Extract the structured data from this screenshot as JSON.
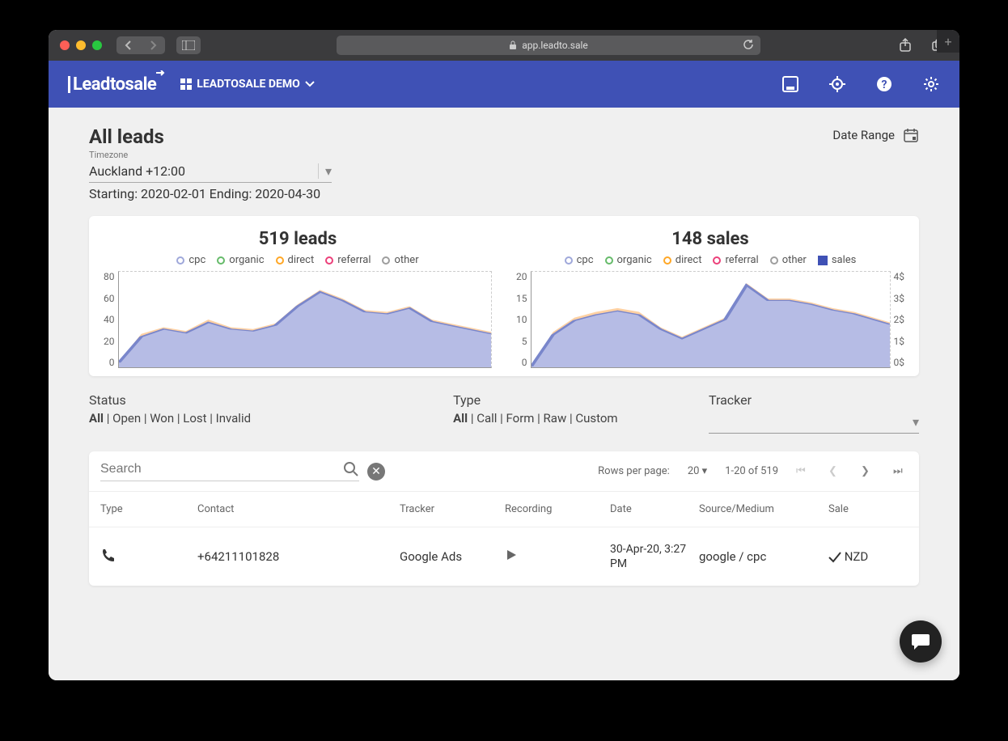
{
  "browser": {
    "url_host": "app.leadto.sale"
  },
  "header": {
    "brand": "Leadtosale",
    "account_selector": "LEADTOSALE DEMO"
  },
  "page": {
    "title": "All leads",
    "timezone_label": "Timezone",
    "timezone_value": "Auckland +12:00",
    "date_summary": "Starting: 2020-02-01 Ending: 2020-04-30",
    "date_range_label": "Date Range"
  },
  "charts": {
    "leads": {
      "title": "519 leads",
      "legend": [
        "cpc",
        "organic",
        "direct",
        "referral",
        "other"
      ]
    },
    "sales": {
      "title": "148 sales",
      "legend": [
        "cpc",
        "organic",
        "direct",
        "referral",
        "other",
        "sales"
      ]
    },
    "y_leads": [
      "80",
      "60",
      "40",
      "20",
      "0"
    ],
    "y_sales_left": [
      "20",
      "15",
      "10",
      "5",
      "0"
    ],
    "y_sales_right": [
      "4$",
      "3$",
      "2$",
      "1$",
      "0$"
    ]
  },
  "chart_data": [
    {
      "type": "area",
      "title": "519 leads",
      "ylabel": "leads",
      "ylim": [
        0,
        80
      ],
      "x_range": "2020-02-01 to 2020-04-30",
      "series": [
        {
          "name": "cpc",
          "color": "#9fa8da",
          "values": [
            5,
            28,
            35,
            32,
            40,
            35,
            33,
            38,
            55,
            68,
            60,
            50,
            48,
            53,
            42,
            38,
            30
          ]
        },
        {
          "name": "organic",
          "color": "#66bb6a",
          "values": [
            0,
            2,
            2,
            2,
            3,
            2,
            2,
            3,
            4,
            4,
            3,
            3,
            3,
            3,
            2,
            2,
            2
          ]
        },
        {
          "name": "direct",
          "color": "#ffa726",
          "values": [
            0,
            3,
            4,
            3,
            5,
            4,
            3,
            4,
            6,
            6,
            5,
            4,
            4,
            5,
            3,
            3,
            3
          ]
        },
        {
          "name": "referral",
          "color": "#ec407a",
          "values": [
            0,
            0,
            0,
            0,
            0,
            0,
            0,
            0,
            0,
            0,
            0,
            0,
            0,
            0,
            0,
            0,
            0
          ]
        },
        {
          "name": "other",
          "color": "#9e9e9e",
          "values": [
            0,
            0,
            0,
            0,
            0,
            0,
            0,
            0,
            0,
            0,
            0,
            0,
            0,
            0,
            0,
            0,
            0
          ]
        }
      ]
    },
    {
      "type": "area",
      "title": "148 sales",
      "ylabel": "sales",
      "ylim": [
        0,
        20
      ],
      "y2label": "$",
      "y2lim": [
        0,
        4
      ],
      "x_range": "2020-02-01 to 2020-04-30",
      "series": [
        {
          "name": "cpc",
          "color": "#9fa8da",
          "values": [
            0,
            7,
            10,
            11,
            12,
            11,
            8,
            6,
            8,
            10,
            18,
            14,
            14,
            13,
            12,
            11,
            9
          ]
        },
        {
          "name": "organic",
          "color": "#66bb6a",
          "values": [
            0,
            0,
            0,
            0,
            0,
            0,
            0,
            0,
            0,
            0,
            0,
            0,
            0,
            0,
            0,
            0,
            0
          ]
        },
        {
          "name": "direct",
          "color": "#ffa726",
          "values": [
            0,
            1,
            1,
            1,
            1,
            1,
            1,
            0,
            1,
            1,
            1,
            1,
            1,
            1,
            1,
            1,
            1
          ]
        },
        {
          "name": "referral",
          "color": "#ec407a",
          "values": [
            0,
            0,
            0,
            0,
            0,
            0,
            0,
            0,
            0,
            0,
            0,
            0,
            0,
            0,
            0,
            0,
            0
          ]
        },
        {
          "name": "other",
          "color": "#9e9e9e",
          "values": [
            0,
            0,
            0,
            0,
            0,
            0,
            0,
            0,
            0,
            0,
            0,
            0,
            0,
            0,
            0,
            0,
            0
          ]
        },
        {
          "name": "sales",
          "color": "#3f51b5",
          "axis": "y2",
          "values": [
            0,
            1.5,
            2,
            2.2,
            2.4,
            2.2,
            1.6,
            1.2,
            1.6,
            2,
            3.5,
            2.8,
            2.8,
            2.6,
            2.4,
            2.2,
            1.8
          ]
        }
      ]
    }
  ],
  "filters": {
    "status_label": "Status",
    "status_opts": [
      "All",
      "Open",
      "Won",
      "Lost",
      "Invalid"
    ],
    "type_label": "Type",
    "type_opts": [
      "All",
      "Call",
      "Form",
      "Raw",
      "Custom"
    ],
    "tracker_label": "Tracker"
  },
  "table": {
    "search_placeholder": "Search",
    "rows_per_page_label": "Rows per page:",
    "rows_per_page_value": "20",
    "pagination": "1-20 of 519",
    "columns": [
      "Type",
      "Contact",
      "Tracker",
      "Recording",
      "Date",
      "Source/Medium",
      "Sale"
    ],
    "rows": [
      {
        "type_icon": "phone-icon",
        "contact": "+64211101828",
        "tracker": "Google Ads",
        "recording": "play",
        "date": "30-Apr-20, 3:27 PM",
        "source": "google / cpc",
        "sale": "NZD"
      }
    ]
  },
  "colors": {
    "cpc": "#9fa8da",
    "organic": "#66bb6a",
    "direct": "#ffa726",
    "referral": "#ec407a",
    "other": "#9e9e9e",
    "sales": "#3f51b5"
  }
}
